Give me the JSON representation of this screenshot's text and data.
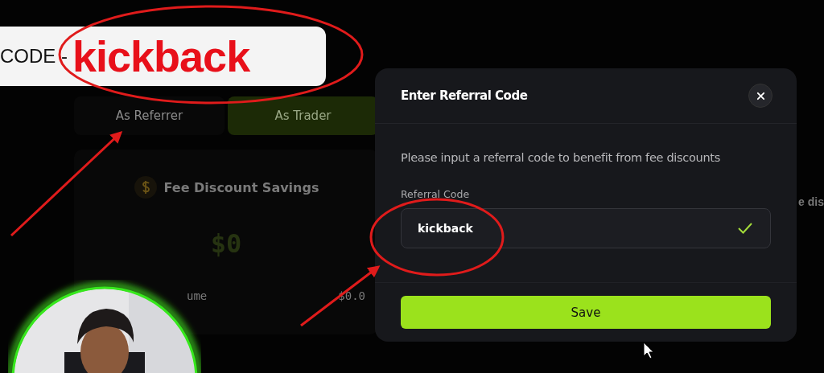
{
  "banner": {
    "prefix": "CODE -",
    "code": "kickback"
  },
  "tabs": [
    {
      "label": "As Referrer",
      "selected": false
    },
    {
      "label": "As Trader",
      "selected": true
    }
  ],
  "savings": {
    "title": "Fee Discount Savings",
    "amount": "$0",
    "row_label": "ume",
    "row_value": "$0.0"
  },
  "side_heading": "e dis",
  "modal": {
    "title": "Enter Referral Code",
    "description": "Please input a referral code to benefit from fee discounts",
    "field": {
      "label": "Referral Code",
      "value": "kickback",
      "valid": true
    },
    "save_button": "Save"
  }
}
